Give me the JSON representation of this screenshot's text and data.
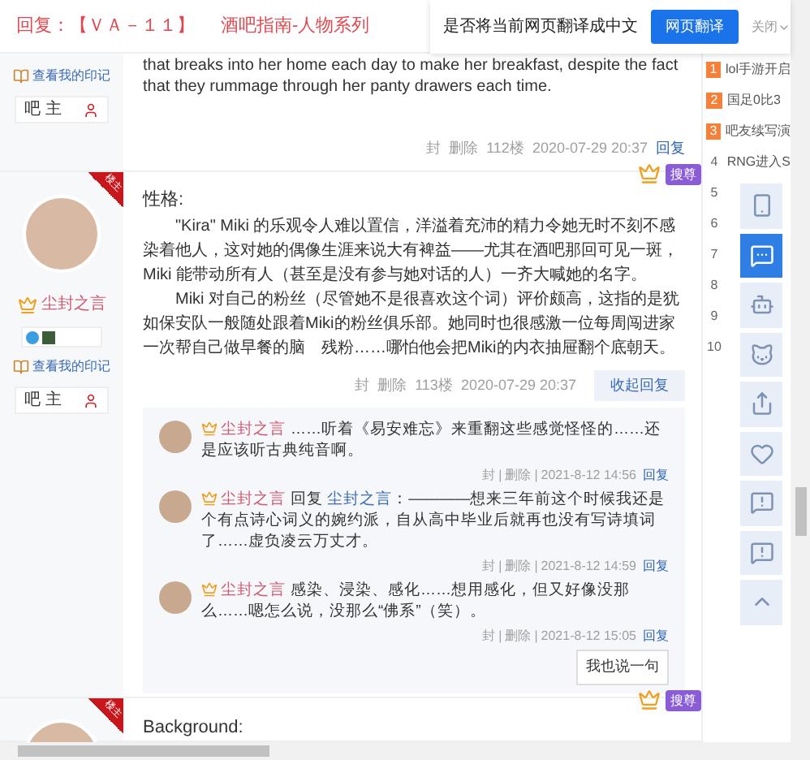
{
  "header": {
    "title": "回复：【ＶＡ－１１】",
    "subtitle": "酒吧指南-人物系列"
  },
  "translate_bar": {
    "prompt": "是否将当前网页翻译成中文",
    "button": "网页翻译",
    "close": "关闭"
  },
  "posts": [
    {
      "kind": "tail",
      "impression": "查看我的印记",
      "rank": "吧 主",
      "paragraphs": [
        "that breaks into her home each day to make her breakfast, despite the fact that they rummage through her panty drawers each time."
      ],
      "footer": {
        "actions": [
          "封",
          "删除"
        ],
        "floor": "112楼",
        "time": "2020-07-29 20:37",
        "reply": "回复",
        "reply_expanded": false
      }
    },
    {
      "kind": "full",
      "badge": "楼主",
      "author": "尘封之言",
      "vip": "搜尊",
      "impression": "查看我的印记",
      "rank": "吧 主",
      "heading": "性格:",
      "paragraphs": [
        "\"Kira\" Miki 的乐观令人难以置信，洋溢着充沛的精力令她无时不刻不感染着他人，这对她的偶像生涯来说大有裨益——尤其在酒吧那回可见一斑，Miki 能带动所有人（甚至是没有参与她对话的人）一齐大喊她的名字。",
        "Miki 对自己的粉丝（尽管她不是很喜欢这个词）评价颇高，这指的是犹如保安队一般随处跟着Miki的粉丝俱乐部。她同时也很感激一位每周闯进家一次帮自己做早餐的脑　残粉……哪怕他会把Miki的内衣抽屉翻个底朝天。"
      ],
      "footer": {
        "actions": [
          "封",
          "删除"
        ],
        "floor": "113楼",
        "time": "2020-07-29 20:37",
        "reply": "收起回复",
        "reply_expanded": true
      },
      "replies": [
        {
          "author": "尘封之言",
          "text": "……听着《易安难忘》来重翻这些感觉怪怪的……还是应该听古典纯音啊。",
          "meta": [
            "封",
            "|",
            "删除",
            "|",
            "2021-8-12 14:56"
          ],
          "reply": "回复"
        },
        {
          "author": "尘封之言",
          "reply_word": "回复",
          "reply_to": "尘封之言",
          "text": "：————想来三年前这个时候我还是个有点诗心词义的婉约派，自从高中毕业后就再也没有写诗填词了……虚负凌云万丈才。",
          "meta": [
            "封",
            "|",
            "删除",
            "|",
            "2021-8-12 14:59"
          ],
          "reply": "回复"
        },
        {
          "author": "尘封之言",
          "text": "感染、浸染、感化……想用感化，但又好像没那么……嗯怎么说，没那么“佛系”（笑）。",
          "meta": [
            "封",
            "|",
            "删除",
            "|",
            "2021-8-12 15:05"
          ],
          "reply": "回复"
        }
      ],
      "say_button": "我也说一句"
    },
    {
      "kind": "head",
      "badge": "楼主",
      "vip": "搜尊",
      "heading": "Background:"
    }
  ],
  "hot_list": [
    {
      "rank": "1",
      "text": "lol手游开启",
      "top": true
    },
    {
      "rank": "2",
      "text": "国足0比3",
      "top": true
    },
    {
      "rank": "3",
      "text": "吧友续写演",
      "top": true
    },
    {
      "rank": "4",
      "text": "RNG进入S",
      "top": false
    },
    {
      "rank": "5",
      "top": false
    },
    {
      "rank": "6",
      "top": false
    },
    {
      "rank": "7",
      "top": false
    },
    {
      "rank": "8",
      "top": false
    },
    {
      "rank": "9",
      "top": false
    },
    {
      "rank": "10",
      "top": false
    }
  ],
  "tools": [
    {
      "kind": "download",
      "selected": false
    },
    {
      "kind": "chat",
      "selected": true
    },
    {
      "kind": "robot",
      "selected": false
    },
    {
      "kind": "cat",
      "selected": false
    },
    {
      "kind": "share",
      "selected": false
    },
    {
      "kind": "heart",
      "selected": false
    },
    {
      "kind": "report",
      "selected": false
    },
    {
      "kind": "report",
      "selected": false
    },
    {
      "kind": "top",
      "selected": false
    }
  ]
}
